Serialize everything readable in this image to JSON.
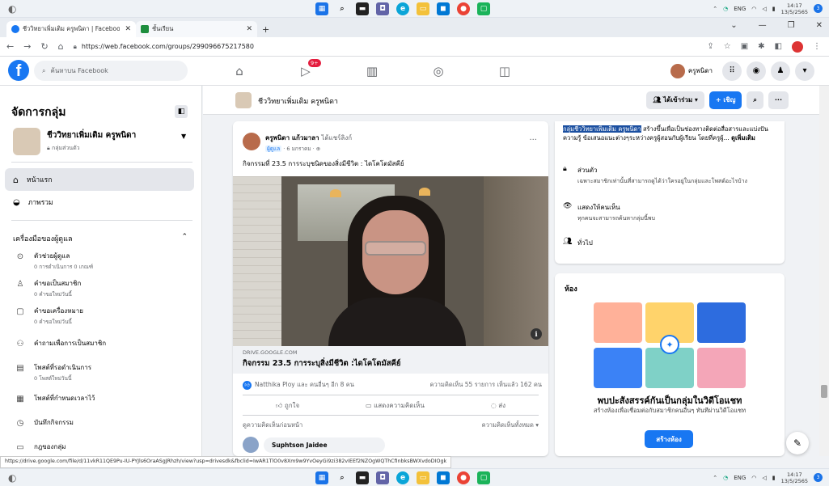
{
  "taskbar": {
    "time": "14:17",
    "date": "13/5/2565",
    "lang": "ENG",
    "notif": "3"
  },
  "browser": {
    "tabs": [
      {
        "title": "ชีววิทยาเพิ่มเติม ครูพนิดา | Facebook",
        "close": "✕"
      },
      {
        "title": "ชั้นเรียน",
        "close": "✕"
      }
    ],
    "new_tab": "+",
    "url": "https://web.facebook.com/groups/299096675217580"
  },
  "fb": {
    "search_placeholder": "ค้นหาบน Facebook",
    "video_badge": "9+",
    "user_name": "ครูพนิดา"
  },
  "sidebar": {
    "title": "จัดการกลุ่ม",
    "group_name": "ชีววิทยาเพิ่มเติม ครูพนิดา",
    "group_privacy": "กลุ่มส่วนตัว",
    "nav": [
      {
        "label": "หน้าแรก"
      },
      {
        "label": "ภาพรวม"
      }
    ],
    "admin_tools_title": "เครื่องมือของผู้ดูแล",
    "tools": [
      {
        "label": "ตัวช่วยผู้ดูแล",
        "sub": "0 การดำเนินการ 0 เกณฑ์"
      },
      {
        "label": "คำขอเป็นสมาชิก",
        "sub": "0 คำขอใหม่วันนี้"
      },
      {
        "label": "คำขอเครื่องหมาย",
        "sub": "0 คำขอใหม่วันนี้"
      },
      {
        "label": "คำถามเพื่อการเป็นสมาชิก",
        "sub": ""
      },
      {
        "label": "โพสต์ที่รอดำเนินการ",
        "sub": "0 โพสต์ใหม่วันนี้"
      },
      {
        "label": "โพสต์ที่กำหนดเวลาไว้",
        "sub": ""
      },
      {
        "label": "บันทึกกิจกรรม",
        "sub": ""
      },
      {
        "label": "กฎของกลุ่ม",
        "sub": ""
      }
    ]
  },
  "group_bar": {
    "name": "ชีววิทยาเพิ่มเติม ครูพนิดา",
    "joined": "ได้เข้าร่วม ▾",
    "invite": "+ เชิญ"
  },
  "post": {
    "author": "ครูพนิดา แก้วมาลา",
    "shared": "ได้แชร์ลิงก์",
    "role": "ผู้ดูแล",
    "date": "· 6 มกราคม · ⊕",
    "text": "กิจกรรมที่ 23.5 การระบุชนิดของสิ่งมีชีวิต : ไดโคโตมัสคีย์",
    "link_domain": "DRIVE.GOOGLE.COM",
    "link_title": "กิจกรรม 23.5 การระบุสิ่งมีชีวิต :ไดโคโตมัสคีย์",
    "reactions": "Natthika Ploy และ คนอื่นๆ อีก 8 คน",
    "counts": "ความคิดเห็น 55 รายการ  เห็นแล้ว 162 คน",
    "like": "ถูกใจ",
    "comment": "แสดงความคิดเห็น",
    "send": "ส่ง",
    "prev_comments": "ดูความคิดเห็นก่อนหน้า",
    "all_comments": "ความคิดเห็นทั้งหมด ▾",
    "commenter": "Suphtson Jaidee"
  },
  "about": {
    "desc_highlight": "กลุ่มชีววิทยาเพิ่มเติม ครูพนิดา",
    "desc_rest": " สร้างขึ้นเพื่อเป็นช่องทางติดต่อสื่อสารและแบ่งปันความรู้ ข้อเสนอแนะต่างๆระหว่างครูผู้สอนกับผู้เรียน โดยที่ครูผู้...",
    "see_more": "ดูเพิ่มเติม",
    "private_title": "ส่วนตัว",
    "private_sub": "เฉพาะสมาชิกเท่านั้นที่สามารถดูได้ว่าใครอยู่ในกลุ่มและโพสต์อะไรบ้าง",
    "visible_title": "แสดงให้คนเห็น",
    "visible_sub": "ทุกคนจะสามารถค้นหากลุ่มนี้พบ",
    "general": "ทั่วไป"
  },
  "rooms": {
    "title": "ห้อง",
    "headline": "พบปะสังสรรค์กันเป็นกลุ่มในวิดีโอแชท",
    "sub": "สร้างห้องเพื่อเชื่อมต่อกับสมาชิกคนอื่นๆ ทันทีผ่านวิดีโอแชท",
    "button": "สร้างห้อง"
  },
  "status_url": "https://drive.google.com/file/d/11vkR11QE9Pu-IU-PYJls6OraASgJRhzh/view?usp=drivesdk&fbclid=IwAR1TlO0v8Xm9w9YvOeyGi9zi382vIEEf2NZOgWQThCfInbksBWXvdoDIOgk"
}
